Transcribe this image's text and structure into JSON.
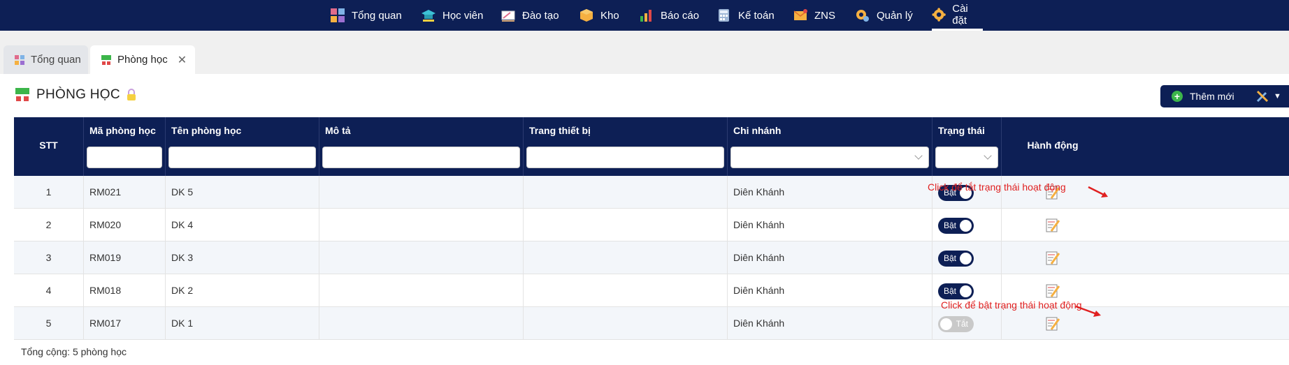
{
  "nav": {
    "items": [
      {
        "label": "Tổng quan",
        "icon": "dashboard-icon"
      },
      {
        "label": "Học viên",
        "icon": "graduation-cap-icon"
      },
      {
        "label": "Đào tạo",
        "icon": "teacher-board-icon"
      },
      {
        "label": "Kho",
        "icon": "box-icon"
      },
      {
        "label": "Báo cáo",
        "icon": "bar-chart-icon"
      },
      {
        "label": "Kế toán",
        "icon": "calculator-icon"
      },
      {
        "label": "ZNS",
        "icon": "mail-icon"
      },
      {
        "label": "Quản lý",
        "icon": "management-gear-icon"
      },
      {
        "label": "Cài đặt",
        "icon": "settings-gear-icon"
      }
    ],
    "active": "Cài đặt"
  },
  "tabs": [
    {
      "label": "Tổng quan",
      "active": false
    },
    {
      "label": "Phòng học",
      "active": true,
      "close": "✕"
    }
  ],
  "page": {
    "title": "PHÒNG HỌC",
    "add_button": "Thêm mới"
  },
  "table": {
    "headers": {
      "stt": "STT",
      "code": "Mã phòng học",
      "name": "Tên phòng học",
      "desc": "Mô tả",
      "equipment": "Trang thiết bị",
      "branch": "Chi nhánh",
      "status": "Trạng thái",
      "action": "Hành động"
    },
    "rows": [
      {
        "stt": "1",
        "code": "RM021",
        "name": "DK 5",
        "desc": "",
        "equipment": "",
        "branch": "Diên Khánh",
        "status": "Bật",
        "on": true
      },
      {
        "stt": "2",
        "code": "RM020",
        "name": "DK 4",
        "desc": "",
        "equipment": "",
        "branch": "Diên Khánh",
        "status": "Bật",
        "on": true
      },
      {
        "stt": "3",
        "code": "RM019",
        "name": "DK 3",
        "desc": "",
        "equipment": "",
        "branch": "Diên Khánh",
        "status": "Bật",
        "on": true
      },
      {
        "stt": "4",
        "code": "RM018",
        "name": "DK 2",
        "desc": "",
        "equipment": "",
        "branch": "Diên Khánh",
        "status": "Bật",
        "on": true
      },
      {
        "stt": "5",
        "code": "RM017",
        "name": "DK 1",
        "desc": "",
        "equipment": "",
        "branch": "Diên Khánh",
        "status": "Tắt",
        "on": false
      }
    ]
  },
  "footer": {
    "total": "Tổng cộng: 5 phòng học"
  },
  "annotations": {
    "off_hint": "Click để tắt trạng thái hoạt động",
    "on_hint": "Click để bật trạng thái hoạt động"
  },
  "colors": {
    "navy": "#0d1f55",
    "annotation": "#e02020",
    "plus": "#3cb54a"
  }
}
